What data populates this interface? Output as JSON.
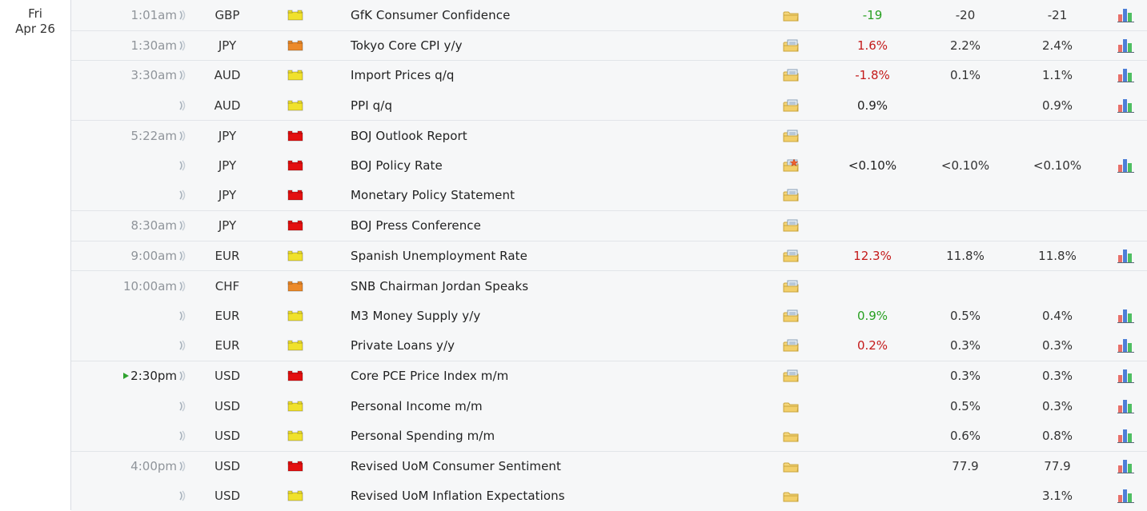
{
  "date": {
    "weekday": "Fri",
    "day": "Apr 26"
  },
  "colors": {
    "impact_high": "#e41010",
    "impact_medium": "#ec8a2a",
    "impact_low": "#f0e12c",
    "actual_better": "#28a021",
    "actual_worse": "#c41a1a",
    "current_marker": "#2fa22f"
  },
  "icons": {
    "sound": "speaker-wave-icon",
    "detail": "folder-icon",
    "graph": "bar-chart-icon",
    "current": "play-arrow-icon"
  },
  "events": [
    {
      "time": "1:01am",
      "currency": "GBP",
      "impact": "low",
      "event": "GfK Consumer Confidence",
      "detail": "plain",
      "actual": "-19",
      "actual_dir": "good",
      "forecast": "-20",
      "previous": "-21",
      "graph": true
    },
    {
      "time": "1:30am",
      "currency": "JPY",
      "impact": "medium",
      "event": "Tokyo Core CPI y/y",
      "detail": "doc",
      "actual": "1.6%",
      "actual_dir": "bad",
      "forecast": "2.2%",
      "previous": "2.4%",
      "graph": true
    },
    {
      "time": "3:30am",
      "currency": "AUD",
      "impact": "low",
      "event": "Import Prices q/q",
      "detail": "doc",
      "actual": "-1.8%",
      "actual_dir": "bad",
      "forecast": "0.1%",
      "previous": "1.1%",
      "graph": true
    },
    {
      "time": "",
      "currency": "AUD",
      "impact": "low",
      "event": "PPI q/q",
      "detail": "doc",
      "actual": "0.9%",
      "actual_dir": "neutral",
      "forecast": "",
      "previous": "0.9%",
      "graph": true
    },
    {
      "time": "5:22am",
      "currency": "JPY",
      "impact": "high",
      "event": "BOJ Outlook Report",
      "detail": "doc",
      "actual": "",
      "actual_dir": "neutral",
      "forecast": "",
      "previous": "",
      "graph": false
    },
    {
      "time": "",
      "currency": "JPY",
      "impact": "high",
      "event": "BOJ Policy Rate",
      "detail": "star",
      "actual": "<0.10%",
      "actual_dir": "neutral",
      "forecast": "<0.10%",
      "previous": "<0.10%",
      "graph": true
    },
    {
      "time": "",
      "currency": "JPY",
      "impact": "high",
      "event": "Monetary Policy Statement",
      "detail": "doc",
      "actual": "",
      "actual_dir": "neutral",
      "forecast": "",
      "previous": "",
      "graph": false
    },
    {
      "time": "8:30am",
      "currency": "JPY",
      "impact": "high",
      "event": "BOJ Press Conference",
      "detail": "doc",
      "actual": "",
      "actual_dir": "neutral",
      "forecast": "",
      "previous": "",
      "graph": false
    },
    {
      "time": "9:00am",
      "currency": "EUR",
      "impact": "low",
      "event": "Spanish Unemployment Rate",
      "detail": "doc",
      "actual": "12.3%",
      "actual_dir": "bad",
      "forecast": "11.8%",
      "previous": "11.8%",
      "graph": true
    },
    {
      "time": "10:00am",
      "currency": "CHF",
      "impact": "medium",
      "event": "SNB Chairman Jordan Speaks",
      "detail": "doc",
      "actual": "",
      "actual_dir": "neutral",
      "forecast": "",
      "previous": "",
      "graph": false
    },
    {
      "time": "",
      "currency": "EUR",
      "impact": "low",
      "event": "M3 Money Supply y/y",
      "detail": "doc",
      "actual": "0.9%",
      "actual_dir": "good",
      "forecast": "0.5%",
      "previous": "0.4%",
      "graph": true
    },
    {
      "time": "",
      "currency": "EUR",
      "impact": "low",
      "event": "Private Loans y/y",
      "detail": "doc",
      "actual": "0.2%",
      "actual_dir": "bad",
      "forecast": "0.3%",
      "previous": "0.3%",
      "graph": true
    },
    {
      "time": "2:30pm",
      "current": true,
      "currency": "USD",
      "impact": "high",
      "event": "Core PCE Price Index m/m",
      "detail": "doc",
      "actual": "",
      "actual_dir": "neutral",
      "forecast": "0.3%",
      "previous": "0.3%",
      "graph": true
    },
    {
      "time": "",
      "currency": "USD",
      "impact": "low",
      "event": "Personal Income m/m",
      "detail": "plain",
      "actual": "",
      "actual_dir": "neutral",
      "forecast": "0.5%",
      "previous": "0.3%",
      "graph": true
    },
    {
      "time": "",
      "currency": "USD",
      "impact": "low",
      "event": "Personal Spending m/m",
      "detail": "plain",
      "actual": "",
      "actual_dir": "neutral",
      "forecast": "0.6%",
      "previous": "0.8%",
      "graph": true
    },
    {
      "time": "4:00pm",
      "currency": "USD",
      "impact": "high",
      "event": "Revised UoM Consumer Sentiment",
      "detail": "plain",
      "actual": "",
      "actual_dir": "neutral",
      "forecast": "77.9",
      "previous": "77.9",
      "graph": true
    },
    {
      "time": "",
      "currency": "USD",
      "impact": "low",
      "event": "Revised UoM Inflation Expectations",
      "detail": "plain",
      "actual": "",
      "actual_dir": "neutral",
      "forecast": "",
      "previous": "3.1%",
      "graph": true
    }
  ]
}
